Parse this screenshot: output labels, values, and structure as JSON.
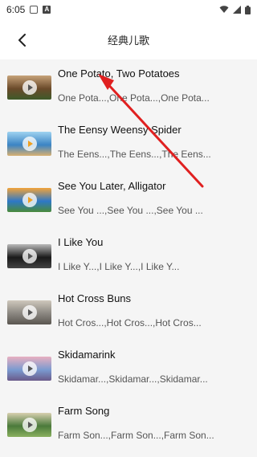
{
  "status_bar": {
    "time": "6:05"
  },
  "header": {
    "title": "经典儿歌",
    "back_icon": "back-arrow-icon"
  },
  "songs": [
    {
      "title": "One Potato, Two Potatoes",
      "subtitle": "One Pota...,One Pota...,One Pota...",
      "thumb_colors": [
        "#6a4a2a",
        "#c7a37a",
        "#3e5a2a"
      ],
      "badge": "gray"
    },
    {
      "title": "The Eensy Weensy Spider",
      "subtitle": "The Eens...,The Eens...,The Eens...",
      "thumb_colors": [
        "#3b84c4",
        "#9fd3f0",
        "#d8b070"
      ],
      "badge": "orange"
    },
    {
      "title": "See You Later, Alligator",
      "subtitle": "See You ...,See You ...,See You ...",
      "thumb_colors": [
        "#2d78c8",
        "#f2a33a",
        "#4a8a3a"
      ],
      "badge": "orange"
    },
    {
      "title": "I Like You",
      "subtitle": "I Like Y...,I Like Y...,I Like Y...",
      "thumb_colors": [
        "#1a1a1a",
        "#bbbbbb",
        "#444444"
      ],
      "badge": "gray"
    },
    {
      "title": "Hot Cross Buns",
      "subtitle": "Hot Cros...,Hot Cros...,Hot Cros...",
      "thumb_colors": [
        "#8a8680",
        "#cfc8bc",
        "#5a5650"
      ],
      "badge": "gray"
    },
    {
      "title": "Skidamarink",
      "subtitle": "Skidamar...,Skidamar...,Skidamar...",
      "thumb_colors": [
        "#7a9ad0",
        "#e8b0c0",
        "#6a5a8a"
      ],
      "badge": "gray"
    },
    {
      "title": "Farm Song",
      "subtitle": "Farm Son...,Farm Son...,Farm Son...",
      "thumb_colors": [
        "#4a7a3a",
        "#d8d0b0",
        "#8ab060"
      ],
      "badge": "gray"
    }
  ],
  "annotation": {
    "color": "#e02020"
  }
}
